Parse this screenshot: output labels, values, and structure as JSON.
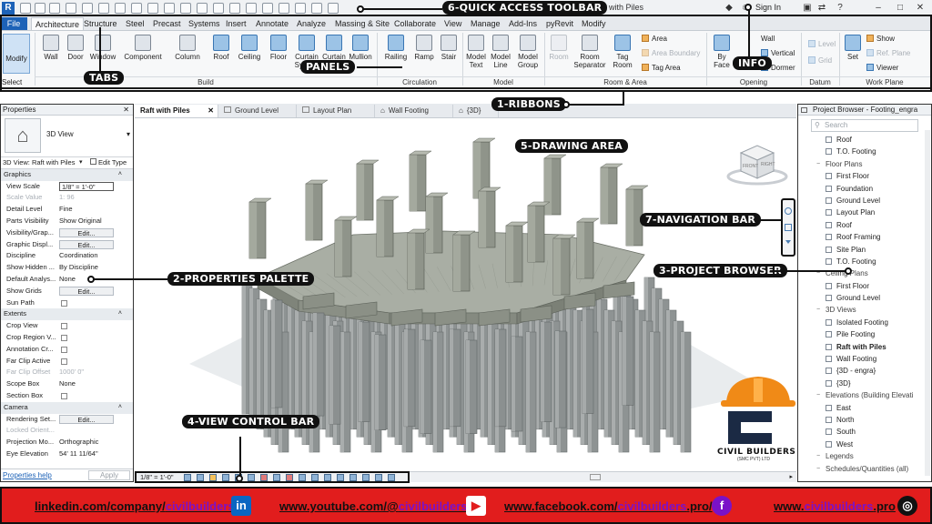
{
  "app": {
    "logo": "R",
    "title": "Raft with Piles",
    "sign_in": "Sign In"
  },
  "tabs": [
    "File",
    "Architecture",
    "Structure",
    "Steel",
    "Precast",
    "Systems",
    "Insert",
    "Annotate",
    "Analyze",
    "Massing & Site",
    "Collaborate",
    "View",
    "Manage",
    "Add-Ins",
    "pyRevit",
    "Modify"
  ],
  "ribbon": {
    "select": "Select",
    "modify": "Modify",
    "build": {
      "label": "Build",
      "items": [
        "Wall",
        "Door",
        "Window",
        "Component",
        "Column",
        "Roof",
        "Ceiling",
        "Floor",
        "Curtain System",
        "Curtain Grid",
        "Mullion"
      ]
    },
    "circulation": {
      "label": "Circulation",
      "items": [
        "Railing",
        "Ramp",
        "Stair"
      ]
    },
    "model": {
      "label": "Model",
      "items": [
        "Model Text",
        "Model Line",
        "Model Group"
      ]
    },
    "room_area": {
      "label": "Room & Area",
      "items": [
        "Room",
        "Room Separator",
        "Tag Room"
      ],
      "small": [
        "Area",
        "Area Boundary",
        "Tag Area"
      ]
    },
    "opening": {
      "label": "Opening",
      "items": [
        "By Face"
      ],
      "small": [
        "Wall",
        "Vertical",
        "Dormer"
      ]
    },
    "datum": {
      "label": "Datum",
      "small": [
        "Level",
        "Grid"
      ]
    },
    "workplane": {
      "label": "Work Plane",
      "items": [
        "Set"
      ],
      "small": [
        "Show",
        "Ref. Plane",
        "Viewer"
      ]
    }
  },
  "properties": {
    "title": "Properties",
    "type": "3D View",
    "view_selector": "3D View: Raft with Piles",
    "edit_type": "Edit Type",
    "rows": [
      {
        "kind": "sec",
        "k": "Graphics"
      },
      {
        "k": "View Scale",
        "v": "1/8\" = 1'-0\"",
        "input": true
      },
      {
        "k": "Scale Value",
        "v": "1:  96",
        "dis": true
      },
      {
        "k": "Detail Level",
        "v": "Fine"
      },
      {
        "k": "Parts Visibility",
        "v": "Show Original"
      },
      {
        "k": "Visibility/Grap...",
        "v": "Edit...",
        "btn": true
      },
      {
        "k": "Graphic Displ...",
        "v": "Edit...",
        "btn": true
      },
      {
        "k": "Discipline",
        "v": "Coordination"
      },
      {
        "k": "Show Hidden ...",
        "v": "By Discipline"
      },
      {
        "k": "Default Analys...",
        "v": "None"
      },
      {
        "k": "Show Grids",
        "v": "Edit...",
        "btn": true
      },
      {
        "k": "Sun Path",
        "chk": true
      },
      {
        "kind": "sec",
        "k": "Extents"
      },
      {
        "k": "Crop View",
        "chk": true
      },
      {
        "k": "Crop Region V...",
        "chk": true
      },
      {
        "k": "Annotation Cr...",
        "chk": true
      },
      {
        "k": "Far Clip Active",
        "chk": true
      },
      {
        "k": "Far Clip Offset",
        "v": "1000'  0\"",
        "dis": true
      },
      {
        "k": "Scope Box",
        "v": "None"
      },
      {
        "k": "Section Box",
        "chk": true
      },
      {
        "kind": "sec",
        "k": "Camera"
      },
      {
        "k": "Rendering Set...",
        "v": "Edit...",
        "btn": true
      },
      {
        "k": "Locked Orient...",
        "dis": true
      },
      {
        "k": "Projection Mo...",
        "v": "Orthographic"
      },
      {
        "k": "Eye Elevation",
        "v": "54'  11 11/64\""
      }
    ],
    "help": "Properties help",
    "apply": "Apply"
  },
  "view_tabs": [
    "Raft with Piles",
    "Ground Level",
    "Layout Plan",
    "Wall Footing",
    "{3D}"
  ],
  "view_control": {
    "scale": "1/8\" = 1'-0\""
  },
  "viewcube": {
    "front": "FRONT",
    "right": "RIGHT"
  },
  "browser": {
    "title": "Project Browser - Footing_engra",
    "search": "Search",
    "tree": [
      {
        "l": 1,
        "t": "Roof"
      },
      {
        "l": 1,
        "t": "T.O. Footing"
      },
      {
        "l": 0,
        "t": "Floor Plans"
      },
      {
        "l": 1,
        "t": "First Floor"
      },
      {
        "l": 1,
        "t": "Foundation"
      },
      {
        "l": 1,
        "t": "Ground Level"
      },
      {
        "l": 1,
        "t": "Layout Plan"
      },
      {
        "l": 1,
        "t": "Roof"
      },
      {
        "l": 1,
        "t": "Roof Framing"
      },
      {
        "l": 1,
        "t": "Site Plan"
      },
      {
        "l": 1,
        "t": "T.O. Footing"
      },
      {
        "l": 0,
        "t": "Ceiling Plans"
      },
      {
        "l": 1,
        "t": "First Floor"
      },
      {
        "l": 1,
        "t": "Ground Level"
      },
      {
        "l": 0,
        "t": "3D Views"
      },
      {
        "l": 1,
        "t": "Isolated Footing"
      },
      {
        "l": 1,
        "t": "Pile Footing"
      },
      {
        "l": 1,
        "t": "Raft with Piles",
        "bold": true
      },
      {
        "l": 1,
        "t": "Wall Footing"
      },
      {
        "l": 1,
        "t": "{3D - engra}"
      },
      {
        "l": 1,
        "t": "{3D}"
      },
      {
        "l": 0,
        "t": "Elevations (Building Elevati"
      },
      {
        "l": 1,
        "t": "East"
      },
      {
        "l": 1,
        "t": "North"
      },
      {
        "l": 1,
        "t": "South"
      },
      {
        "l": 1,
        "t": "West"
      },
      {
        "l": 0,
        "t": "Legends"
      },
      {
        "l": 0,
        "t": "Schedules/Quantities (all)"
      }
    ]
  },
  "annotations": {
    "qat": "6-QUICK ACCESS TOOLBAR",
    "tabs": "TABS",
    "panels": "PANELS",
    "info": "INFO",
    "ribbons": "1-RIBBONS",
    "drawing": "5-DRAWING AREA",
    "nav": "7-NAVIGATION BAR",
    "browser": "3-PROJECT BROWSER",
    "props": "2-PROPERTIES PALETTE",
    "vcb": "4-VIEW CONTROL BAR"
  },
  "watermark": {
    "name": "CIVIL BUILDERS",
    "sub": "(SMC PVT) LTD"
  },
  "footer": {
    "linkedin_pre": "linkedin.com/company/",
    "linkedin_acc": "civilbuilders",
    "youtube_pre": "www.youtube.com/@",
    "youtube_acc": "civilbuilders",
    "facebook_pre": "www.facebook.com/",
    "facebook_acc": "civilbuilders",
    "facebook_post": ".pro/",
    "web_pre": "www.",
    "web_acc": "civilbuilders",
    "web_post": ".pro"
  },
  "colors": {
    "accent": "#1d62b7",
    "footer_bg": "#e11d1d",
    "footer_accent": "#7a12c8",
    "label_bg": "#111111",
    "concrete": "#8f9494"
  }
}
